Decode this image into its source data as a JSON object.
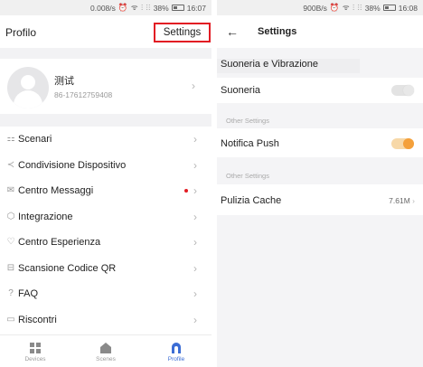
{
  "left": {
    "status": {
      "speed": "0.008/s",
      "glyphs": "⏰ ᯤ ⫶ ⫶⫶",
      "battery": "38%",
      "time": "16:07"
    },
    "title": "Profilo",
    "settings_label": "Settings",
    "profile": {
      "name": "测试",
      "phone": "86-17612759408"
    },
    "menu": [
      {
        "icon": "⚏",
        "label": "Scenari"
      },
      {
        "icon": "≺",
        "label": "Condivisione Dispositivo"
      },
      {
        "icon": "✉",
        "label": "Centro Messaggi"
      },
      {
        "icon": "⬡",
        "label": "Integrazione"
      },
      {
        "icon": "♡",
        "label": "Centro Esperienza"
      },
      {
        "icon": "⊟",
        "label": "Scansione Codice QR"
      },
      {
        "icon": "?",
        "label": "FAQ"
      },
      {
        "icon": "▭",
        "label": "Riscontri"
      }
    ],
    "tabs": [
      {
        "label": "Devices"
      },
      {
        "label": "Scenes"
      },
      {
        "label": "Profile"
      }
    ],
    "accent_color": "#3c6dd5",
    "highlight_color": "#e21b23"
  },
  "right": {
    "status": {
      "speed": "900B/s",
      "glyphs": "⏰ ᯤ ⫶ ⫶⫶",
      "battery": "38%",
      "time": "16:08"
    },
    "back_glyph": "←",
    "title": "Settings",
    "section_sound": "Suoneria e Vibrazione",
    "ringtone_label": "Suoneria",
    "ringtone_on": false,
    "other_settings_1": "Other Settings",
    "push_label": "Notifica Push",
    "push_on": true,
    "other_settings_2": "Other Settings",
    "cache_label": "Pulizia Cache",
    "cache_value": "7.61M",
    "toggle_on_color": "#f4a03b"
  }
}
